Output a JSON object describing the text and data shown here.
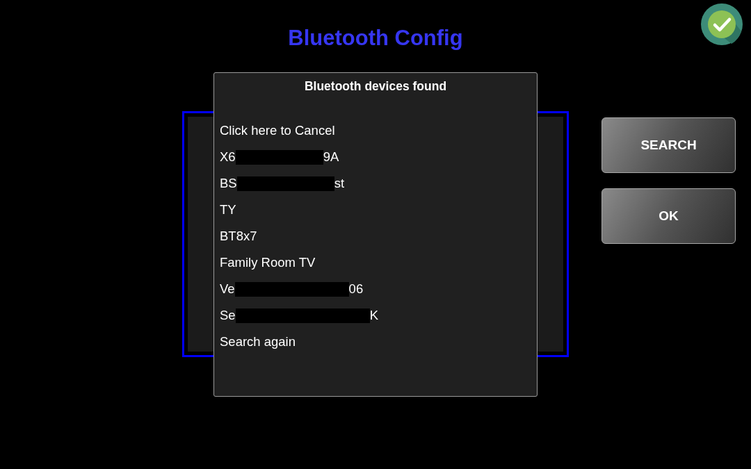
{
  "title": "Bluetooth Config",
  "buttons": [
    {
      "label": "SEARCH"
    },
    {
      "label": "OK"
    }
  ],
  "dialog": {
    "title": "Bluetooth devices found",
    "items": [
      {
        "kind": "text",
        "label": "Click here to Cancel"
      },
      {
        "kind": "redacted",
        "start": "X6",
        "end": "9A"
      },
      {
        "kind": "redacted",
        "start": "BS",
        "end": "st"
      },
      {
        "kind": "text",
        "label": "TY"
      },
      {
        "kind": "text",
        "label": "BT8x7"
      },
      {
        "kind": "text",
        "label": "Family Room TV"
      },
      {
        "kind": "redacted",
        "start": "Ve",
        "end": "06"
      },
      {
        "kind": "redacted",
        "start": "Se",
        "end": "K"
      },
      {
        "kind": "text",
        "label": "Search again"
      }
    ]
  }
}
